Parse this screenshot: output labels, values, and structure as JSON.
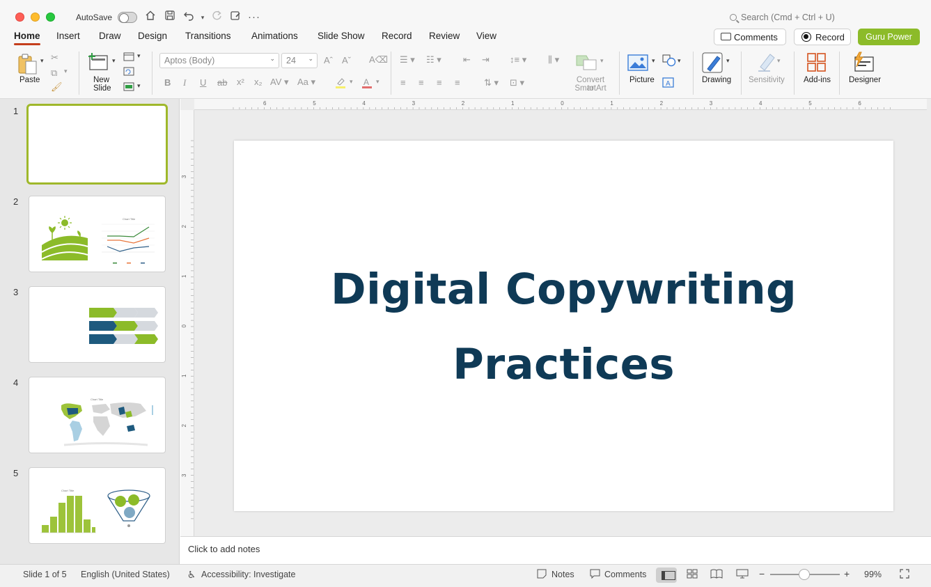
{
  "titlebar": {
    "autosave_label": "AutoSave",
    "autosave_on": false,
    "search_placeholder": "Search (Cmd + Ctrl + U)"
  },
  "tabs": [
    {
      "label": "Home",
      "active": true
    },
    {
      "label": "Insert"
    },
    {
      "label": "Draw"
    },
    {
      "label": "Design"
    },
    {
      "label": "Transitions"
    },
    {
      "label": "Animations"
    },
    {
      "label": "Slide Show"
    },
    {
      "label": "Record"
    },
    {
      "label": "Review"
    },
    {
      "label": "View"
    }
  ],
  "header_buttons": {
    "comments": "Comments",
    "record": "Record",
    "guru": "Guru Power"
  },
  "ribbon": {
    "paste": "Paste",
    "new_slide_line1": "New",
    "new_slide_line2": "Slide",
    "font_name": "Aptos (Body)",
    "font_size": "24",
    "convert_line1": "Convert to",
    "convert_line2": "SmartArt",
    "picture": "Picture",
    "drawing": "Drawing",
    "sensitivity": "Sensitivity",
    "addins": "Add-ins",
    "designer": "Designer"
  },
  "slides": [
    {
      "number": "1",
      "active": true
    },
    {
      "number": "2"
    },
    {
      "number": "3"
    },
    {
      "number": "4"
    },
    {
      "number": "5"
    }
  ],
  "thumb_text": {
    "chart_title": "Chart Title"
  },
  "ruler": {
    "h_labels": [
      "6",
      "5",
      "4",
      "3",
      "2",
      "1",
      "0",
      "1",
      "2",
      "3",
      "4",
      "5",
      "6"
    ],
    "v_labels": [
      "3",
      "2",
      "1",
      "0",
      "1",
      "2",
      "3"
    ]
  },
  "slide": {
    "title_line1": "Digital Copywriting",
    "title_line2": "Practices",
    "title_color": "#0f3a56"
  },
  "notes_placeholder": "Click to add notes",
  "status": {
    "slide_pos": "Slide 1 of 5",
    "language": "English (United States)",
    "accessibility": "Accessibility: Investigate",
    "notes": "Notes",
    "comments": "Comments",
    "zoom": "99%"
  },
  "colors": {
    "accent_green": "#8cbb29",
    "tab_underline": "#c43e1c",
    "dark_blue": "#1e5a7e"
  }
}
